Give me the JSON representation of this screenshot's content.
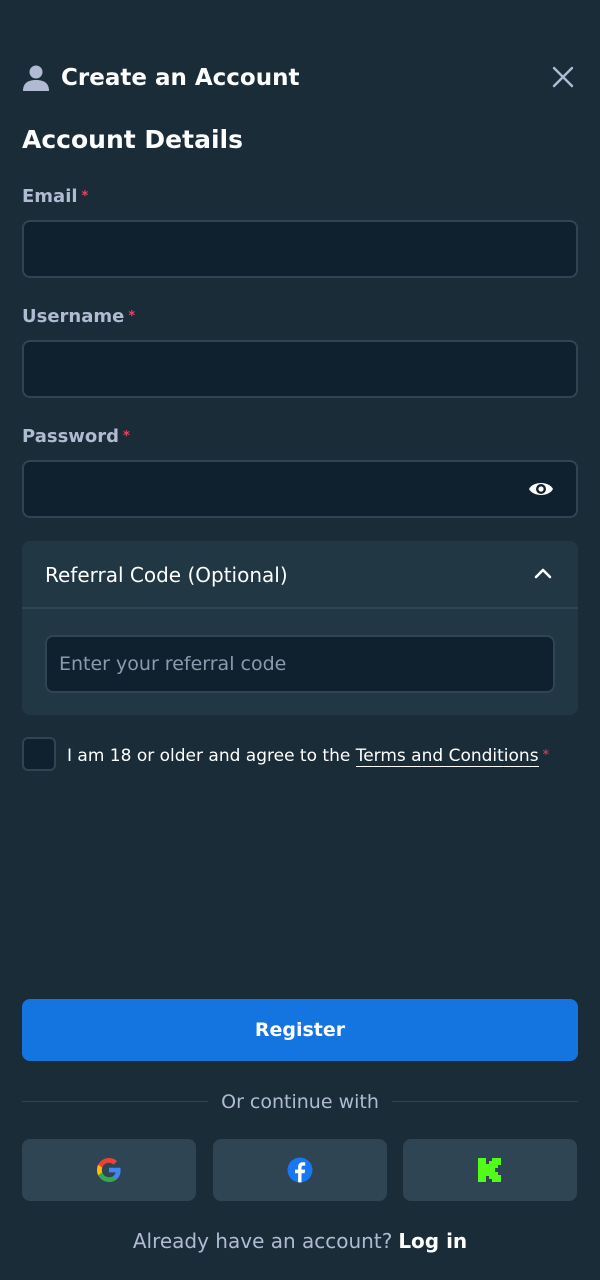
{
  "header": {
    "icon": "user-icon",
    "title": "Create an Account",
    "close_icon": "close-icon"
  },
  "section_title": "Account Details",
  "fields": {
    "email": {
      "label": "Email",
      "required_mark": "*",
      "value": ""
    },
    "username": {
      "label": "Username",
      "required_mark": "*",
      "value": ""
    },
    "password": {
      "label": "Password",
      "required_mark": "*",
      "value": "",
      "toggle_icon": "eye-icon"
    }
  },
  "referral": {
    "label": "Referral Code (Optional)",
    "expanded": true,
    "toggle_icon": "chevron-up-icon",
    "placeholder": "Enter your referral code",
    "value": ""
  },
  "terms": {
    "checked": false,
    "text": "I am 18 or older and agree to the",
    "link_text": "Terms and Conditions",
    "required_mark": "*"
  },
  "register_label": "Register",
  "divider_text": "Or continue with",
  "social": [
    {
      "name": "google",
      "icon": "google-icon"
    },
    {
      "name": "facebook",
      "icon": "facebook-icon"
    },
    {
      "name": "kick",
      "icon": "kick-icon"
    }
  ],
  "login": {
    "prompt": "Already have an account?",
    "link_text": "Log in"
  },
  "colors": {
    "background": "#1a2c38",
    "input_bg": "#0f212e",
    "border": "#2f4553",
    "panel": "#213743",
    "primary": "#1475e1",
    "required": "#ed4163",
    "muted_text": "#b1bad3",
    "google_blue": "#4285F4",
    "google_red": "#EA4335",
    "google_yellow": "#FBBC05",
    "google_green": "#34A853",
    "facebook_blue": "#1877F2",
    "kick_green": "#53FC18"
  }
}
